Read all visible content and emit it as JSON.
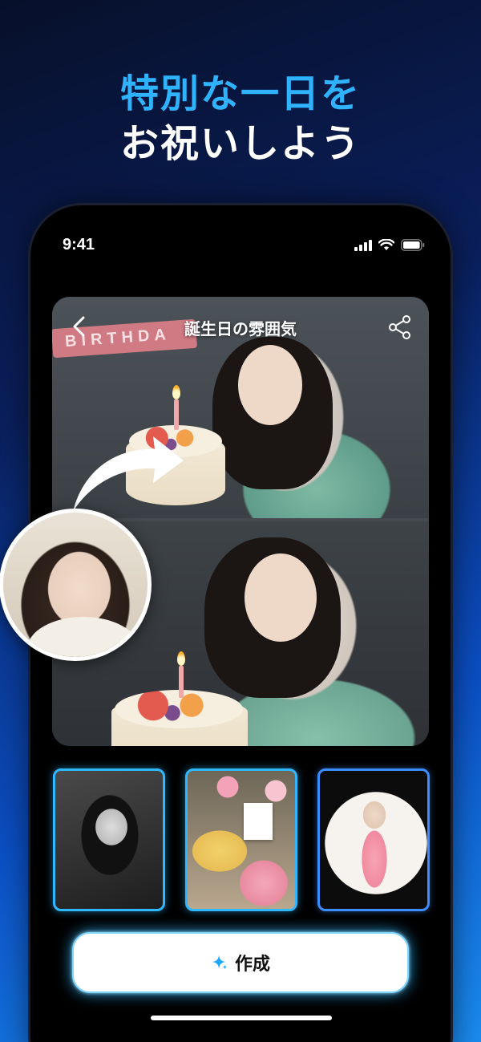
{
  "promo": {
    "headline_line1": "特別な一日を",
    "headline_line2": "お祝いしよう"
  },
  "status_bar": {
    "time": "9:41",
    "icons": [
      "cellular-signal-icon",
      "wifi-icon",
      "battery-icon"
    ]
  },
  "hero": {
    "title": "誕生日の雰囲気",
    "banner_text": "BIRTHDA",
    "back_icon": "chevron-left-icon",
    "share_icon": "share-icon"
  },
  "templates": [
    {
      "name": "monochrome-portrait"
    },
    {
      "name": "cake-and-camera"
    },
    {
      "name": "birthday-board"
    }
  ],
  "cta": {
    "label": "作成",
    "icon": "sparkle-icon"
  },
  "colors": {
    "accent": "#2fb3ff",
    "headline_white": "#ffffff",
    "thumb_border": "#2fb8ff"
  }
}
